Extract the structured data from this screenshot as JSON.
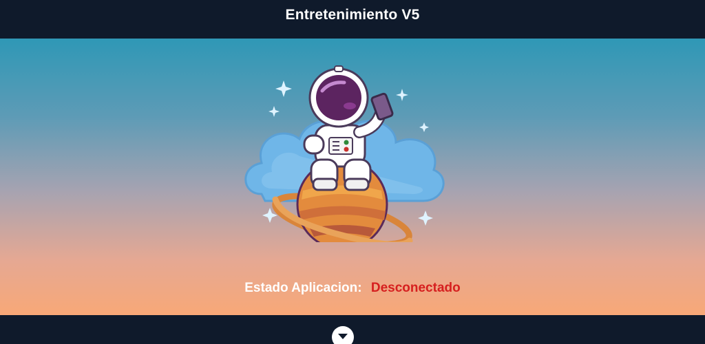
{
  "header": {
    "title": "Entretenimiento V5"
  },
  "status": {
    "label": "Estado Aplicacion:",
    "value": "Desconectado",
    "value_color": "#d61f1f"
  },
  "icons": {
    "hero_illustration": "astronaut-on-planet-icon",
    "expand": "chevron-down-icon"
  },
  "colors": {
    "bar_background": "#0f1a2b",
    "gradient_top": "#2f98b6",
    "gradient_bottom": "#f8a877"
  }
}
